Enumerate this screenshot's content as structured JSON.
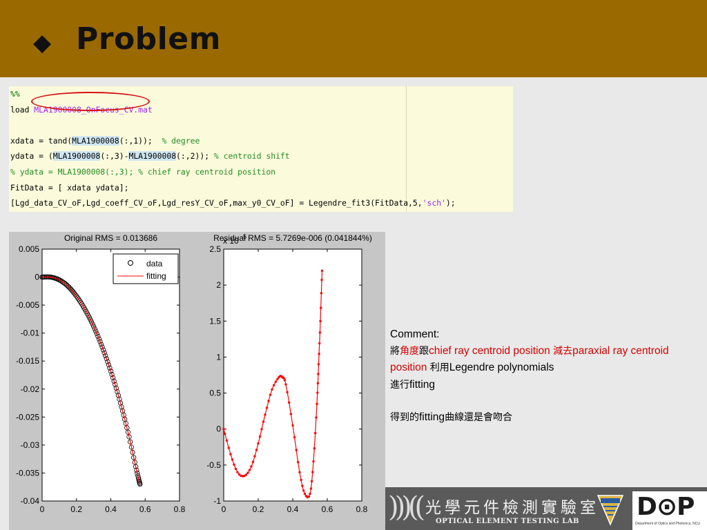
{
  "slide": {
    "title": "Problem",
    "bullet": "◆"
  },
  "code_lines": [
    [
      {
        "t": "%%",
        "c": "cmt",
        "b": true
      }
    ],
    [
      {
        "t": "load "
      },
      {
        "t": "MLA1900008_OnFocus_CV.mat",
        "c": "str"
      }
    ],
    [],
    [
      {
        "t": "xdata = tand("
      },
      {
        "t": "MLA1900008",
        "c": "hl"
      },
      {
        "t": "(:,1));  "
      },
      {
        "t": "% degree",
        "c": "cmt"
      }
    ],
    [
      {
        "t": "ydata = ("
      },
      {
        "t": "MLA1900008",
        "c": "hl"
      },
      {
        "t": "(:,3)-"
      },
      {
        "t": "MLA1900008",
        "c": "hl"
      },
      {
        "t": "(:,2)); "
      },
      {
        "t": "% centroid shift",
        "c": "cmt"
      }
    ],
    [
      {
        "t": "% ydata = MLA1900008(:,3); % chief ray centroid position",
        "c": "cmt"
      }
    ],
    [
      {
        "t": "FitData = [ xdata ydata];"
      }
    ],
    [
      {
        "t": "[Lgd_data_CV_oF,Lgd_coeff_CV_oF,Lgd_resY_CV_oF,max_y0_CV_oF] = Legendre_fit3(FitData,5,"
      },
      {
        "t": "'sch'",
        "c": "str"
      },
      {
        "t": ");"
      }
    ]
  ],
  "chart_data": [
    {
      "type": "scatter",
      "title": "Original RMS = 0.013686",
      "xlim": [
        0,
        0.8
      ],
      "ylim": [
        -0.04,
        0.005
      ],
      "xticks": [
        "0",
        "0.2",
        "0.4",
        "0.6",
        "0.8"
      ],
      "yticks": [
        "0.005",
        "0",
        "-0.005",
        "-0.01",
        "-0.015",
        "-0.02",
        "-0.025",
        "-0.03",
        "-0.035",
        "-0.04"
      ],
      "legend": {
        "position": "top-right",
        "entries": [
          "data",
          "fitting"
        ]
      },
      "series": [
        {
          "name": "data",
          "marker": "circle",
          "color": "#000000",
          "x": [
            0,
            0.05,
            0.1,
            0.15,
            0.2,
            0.25,
            0.3,
            0.35,
            0.4,
            0.45,
            0.5,
            0.55,
            0.57
          ],
          "y": [
            0,
            0,
            -0.0005,
            -0.0016,
            -0.0034,
            -0.0058,
            -0.0088,
            -0.0125,
            -0.0168,
            -0.0218,
            -0.0277,
            -0.0345,
            -0.037
          ]
        },
        {
          "name": "fitting",
          "marker": "line",
          "color": "#ff0000",
          "x": [
            0,
            0.05,
            0.1,
            0.15,
            0.2,
            0.25,
            0.3,
            0.35,
            0.4,
            0.45,
            0.5,
            0.55,
            0.57
          ],
          "y": [
            0,
            0,
            -0.0005,
            -0.0016,
            -0.0034,
            -0.0058,
            -0.0088,
            -0.0125,
            -0.0168,
            -0.0218,
            -0.0277,
            -0.0345,
            -0.037
          ]
        }
      ]
    },
    {
      "type": "line",
      "title": "Residual RMS = 5.7269e-006 (0.041844%)",
      "exponent_label": "x 10",
      "exponent_power": "-5",
      "xlim": [
        0,
        0.8
      ],
      "ylim": [
        -1,
        2.5
      ],
      "xticks": [
        "0",
        "0.2",
        "0.4",
        "0.6",
        "0.8"
      ],
      "yticks": [
        "2.5",
        "2",
        "1.5",
        "1",
        "0.5",
        "0",
        "-0.5",
        "-1"
      ],
      "series": [
        {
          "color": "#ff0000",
          "marker": "dot",
          "x": [
            0,
            0.04,
            0.08,
            0.12,
            0.16,
            0.2,
            0.24,
            0.28,
            0.32,
            0.34,
            0.36,
            0.4,
            0.44,
            0.47,
            0.5,
            0.52,
            0.54,
            0.55,
            0.56,
            0.57
          ],
          "y": [
            0,
            -0.35,
            -0.6,
            -0.65,
            -0.52,
            -0.2,
            0.2,
            0.55,
            0.72,
            0.72,
            0.62,
            0.05,
            -0.6,
            -0.9,
            -0.9,
            -0.45,
            0.35,
            0.9,
            1.5,
            2.2
          ]
        }
      ]
    }
  ],
  "comment": {
    "heading": "Comment:",
    "line1_a": "將",
    "line1_b": "角度",
    "line1_c": "跟",
    "line1_d": "chief ray centroid position ",
    "line1_e": "減去",
    "line1_f": "paraxial ray centroid position ",
    "line1_g": "利用",
    "line1_h": "Legendre polynomials",
    "line2_a": "進行",
    "line2_b": "fitting",
    "line3_a": "得到的",
    "line3_b": "fitting",
    "line3_c": "曲線還是會吻合"
  },
  "footer": {
    "lab_name_cn": "光學元件檢測實驗室",
    "lab_name_en": "OPTICAL ELEMENT TESTING LAB",
    "logo_text": "D⊙P",
    "logo_sub": "Department of Optics and Photonics, NCU"
  },
  "colors": {
    "header_bg": "#9a6a00",
    "code_bg": "#fbfbdc",
    "plot_red": "#ff0000"
  }
}
